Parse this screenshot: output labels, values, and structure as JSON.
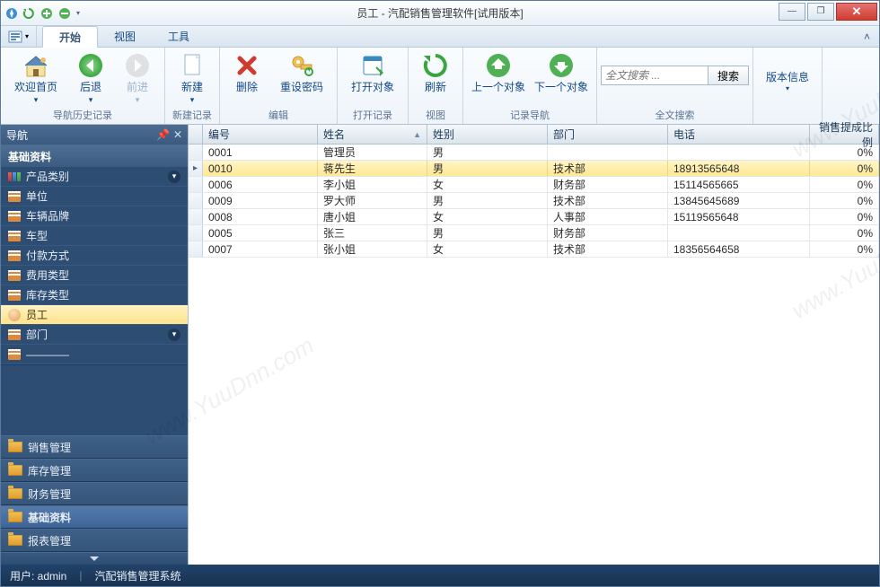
{
  "title": "员工 - 汽配销售管理软件[试用版本]",
  "menubar": {
    "tabs": [
      "开始",
      "视图",
      "工具"
    ],
    "active": 0
  },
  "ribbon": {
    "groups": [
      {
        "label": "导航历史记录",
        "buttons": [
          {
            "name": "home",
            "label": "欢迎首页",
            "disabled": false,
            "caret": true
          },
          {
            "name": "back",
            "label": "后退",
            "disabled": false,
            "caret": true
          },
          {
            "name": "forward",
            "label": "前进",
            "disabled": true,
            "caret": true
          }
        ]
      },
      {
        "label": "新建记录",
        "buttons": [
          {
            "name": "new",
            "label": "新建",
            "disabled": false,
            "caret": true
          }
        ]
      },
      {
        "label": "编辑",
        "buttons": [
          {
            "name": "delete",
            "label": "删除",
            "disabled": false
          },
          {
            "name": "resetpwd",
            "label": "重设密码",
            "disabled": false
          }
        ]
      },
      {
        "label": "打开记录",
        "buttons": [
          {
            "name": "openobj",
            "label": "打开对象",
            "disabled": false
          }
        ]
      },
      {
        "label": "视图",
        "buttons": [
          {
            "name": "refresh",
            "label": "刷新",
            "disabled": false
          }
        ]
      },
      {
        "label": "记录导航",
        "buttons": [
          {
            "name": "prevobj",
            "label": "上一个对象",
            "disabled": false
          },
          {
            "name": "nextobj",
            "label": "下一个对象",
            "disabled": false
          }
        ]
      },
      {
        "label": "全文搜索",
        "search": {
          "placeholder": "全文搜索 ...",
          "button": "搜索"
        }
      },
      {
        "label": "",
        "buttons": [
          {
            "name": "version",
            "label": "版本信息",
            "simple": true
          }
        ]
      }
    ]
  },
  "sidebar": {
    "title": "导航",
    "section": "基础资料",
    "items": [
      {
        "name": "product-category",
        "label": "产品类别",
        "icon": "option",
        "chev": true
      },
      {
        "name": "unit",
        "label": "单位",
        "icon": "list"
      },
      {
        "name": "vehicle-brand",
        "label": "车辆品牌",
        "icon": "list"
      },
      {
        "name": "vehicle-model",
        "label": "车型",
        "icon": "list"
      },
      {
        "name": "payment-method",
        "label": "付款方式",
        "icon": "list"
      },
      {
        "name": "expense-type",
        "label": "费用类型",
        "icon": "list"
      },
      {
        "name": "inventory-type",
        "label": "库存类型",
        "icon": "list"
      },
      {
        "name": "employee",
        "label": "员工",
        "icon": "user",
        "active": true
      },
      {
        "name": "department",
        "label": "部门",
        "icon": "list",
        "chev": true
      },
      {
        "name": "more",
        "label": "――――",
        "icon": "list"
      }
    ],
    "bottom": [
      {
        "name": "sales-mgmt",
        "label": "销售管理"
      },
      {
        "name": "inventory-mgmt",
        "label": "库存管理"
      },
      {
        "name": "finance-mgmt",
        "label": "财务管理"
      },
      {
        "name": "base-data",
        "label": "基础资料",
        "ex": true
      },
      {
        "name": "report-mgmt",
        "label": "报表管理"
      }
    ]
  },
  "grid": {
    "columns": [
      {
        "key": "id",
        "label": "编号"
      },
      {
        "key": "name",
        "label": "姓名",
        "sort": true
      },
      {
        "key": "gender",
        "label": "姓别"
      },
      {
        "key": "dept",
        "label": "部门"
      },
      {
        "key": "phone",
        "label": "电话"
      },
      {
        "key": "comm",
        "label": "销售提成比例"
      }
    ],
    "rows": [
      {
        "id": "0001",
        "name": "管理员",
        "gender": "男",
        "dept": "",
        "phone": "",
        "comm": "0%"
      },
      {
        "id": "0010",
        "name": "蒋先生",
        "gender": "男",
        "dept": "技术部",
        "phone": "18913565648",
        "comm": "0%",
        "selected": true
      },
      {
        "id": "0006",
        "name": "李小姐",
        "gender": "女",
        "dept": "财务部",
        "phone": "15114565665",
        "comm": "0%"
      },
      {
        "id": "0009",
        "name": "罗大师",
        "gender": "男",
        "dept": "技术部",
        "phone": "13845645689",
        "comm": "0%"
      },
      {
        "id": "0008",
        "name": "唐小姐",
        "gender": "女",
        "dept": "人事部",
        "phone": "15119565648",
        "comm": "0%"
      },
      {
        "id": "0005",
        "name": "张三",
        "gender": "男",
        "dept": "财务部",
        "phone": "",
        "comm": "0%"
      },
      {
        "id": "0007",
        "name": "张小姐",
        "gender": "女",
        "dept": "技术部",
        "phone": "18356564658",
        "comm": "0%"
      }
    ]
  },
  "statusbar": {
    "user_label": "用户: ",
    "user": "admin",
    "system": "汽配销售管理系统"
  },
  "watermark": "www.YuuDnn.com"
}
